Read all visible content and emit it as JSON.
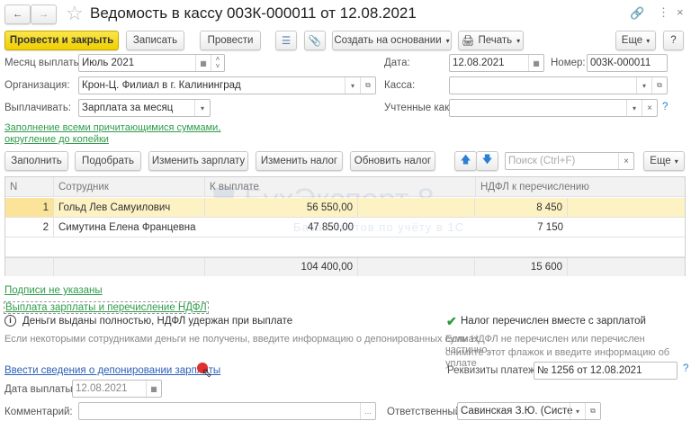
{
  "window": {
    "title": "Ведомость в кассу 003К-000011 от 12.08.2021"
  },
  "toolbar": {
    "post_close": "Провести и закрыть",
    "save": "Записать",
    "post": "Провести",
    "create_based": "Создать на основании",
    "print": "Печать",
    "more": "Еще",
    "help": "?"
  },
  "form": {
    "month_label": "Месяц выплаты:",
    "month_value": "Июль 2021",
    "date_label": "Дата:",
    "date_value": "12.08.2021",
    "number_label": "Номер:",
    "number_value": "003К-000011",
    "org_label": "Организация:",
    "org_value": "Крон-Ц. Филиал в г. Калининград",
    "cash_label": "Касса:",
    "cash_value": "",
    "pay_label": "Выплачивать:",
    "pay_value": "Зарплата за месяц",
    "accounted_label": "Учтенные как:",
    "accounted_value": "",
    "fill_link": "Заполнение всеми причитающимися суммами, округление до копейки"
  },
  "table_toolbar": {
    "fill": "Заполнить",
    "pick": "Подобрать",
    "change_salary": "Изменить зарплату",
    "change_tax": "Изменить налог",
    "update_tax": "Обновить налог",
    "search_placeholder": "Поиск (Ctrl+F)",
    "more": "Еще"
  },
  "table": {
    "columns": [
      "N",
      "Сотрудник",
      "К выплате",
      "НДФЛ к перечислению"
    ],
    "rows": [
      {
        "n": "1",
        "employee": "Гольд Лев Самуилович",
        "pay": "56 550,00",
        "tax": "8 450"
      },
      {
        "n": "2",
        "employee": "Симутина Елена Францевна",
        "pay": "47 850,00",
        "tax": "7 150"
      }
    ],
    "total_pay": "104 400,00",
    "total_tax": "15 600"
  },
  "watermark": {
    "title": "БухЭксперт 8",
    "subtitle": "База ответов по учёту в 1С"
  },
  "bottom": {
    "signatures_link": "Подписи не указаны",
    "section_link": "Выплата зарплаты и перечисление НДФЛ",
    "info_text": "Деньги выданы полностью, НДФЛ удержан при выплате",
    "hint_left": "Если некоторыми сотрудниками деньги не получены, введите информацию о депонированных суммах",
    "deposit_link": "Ввести сведения о депонировании зарплаты",
    "tax_checkbox_label": "Налог перечислен вместе с зарплатой",
    "tax_checked": true,
    "hint_right_1": "Если НДФЛ не перечислен или перечислен частично,",
    "hint_right_2": "снимите этот флажок и введите информацию об уплате",
    "payment_label": "Реквизиты платежа:",
    "payment_value": "№ 1256 от 12.08.2021",
    "paydate_label": "Дата выплаты:",
    "paydate_value": "12.08.2021",
    "comment_label": "Комментарий:",
    "comment_value": "",
    "responsible_label": "Ответственный:",
    "responsible_value": "Савинская З.Ю. (Системный"
  },
  "colors": {
    "accent_yellow": "#f5d800",
    "selected_row": "#fdf2c4",
    "link_green": "#2f9b4b",
    "link_blue": "#2c5fb7"
  }
}
